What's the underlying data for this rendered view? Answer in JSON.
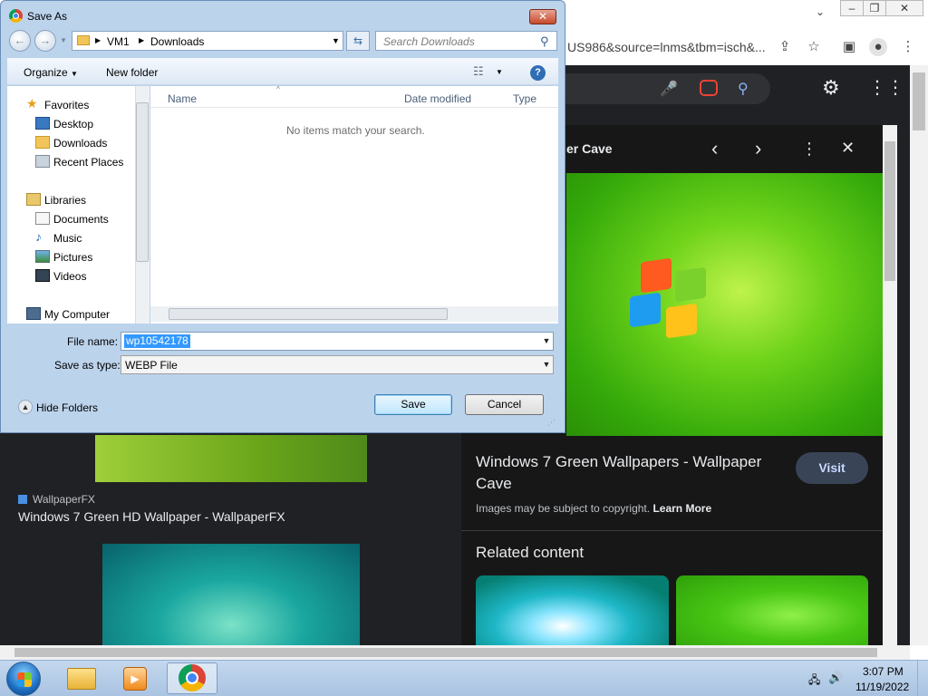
{
  "dialog": {
    "title": "Save As",
    "breadcrumb": [
      "VM1",
      "Downloads"
    ],
    "search_placeholder": "Search Downloads",
    "toolbar": {
      "organize": "Organize",
      "new_folder": "New folder"
    },
    "nav": {
      "favorites": "Favorites",
      "desktop": "Desktop",
      "downloads": "Downloads",
      "recent": "Recent Places",
      "libraries": "Libraries",
      "documents": "Documents",
      "music": "Music",
      "pictures": "Pictures",
      "videos": "Videos",
      "computer": "My Computer"
    },
    "columns": {
      "name": "Name",
      "date": "Date modified",
      "type": "Type"
    },
    "empty_message": "No items match your search.",
    "file_name_label": "File name:",
    "file_name_value": "wp10542178",
    "save_type_label": "Save as type:",
    "save_type_value": "WEBP File",
    "hide_folders": "Hide Folders",
    "save": "Save",
    "cancel": "Cancel"
  },
  "browser": {
    "url_fragment": "US986&source=lnms&tbm=isch&...",
    "preview_title_fragment": "er Cave",
    "result_title": "Windows 7 Green Wallpapers - Wallpaper Cave",
    "visit": "Visit",
    "copyright": "Images may be subject to copyright.",
    "learn_more": "Learn More",
    "related": "Related content",
    "left_source": "WallpaperFX",
    "left_title": "Windows 7 Green HD Wallpaper - WallpaperFX"
  },
  "taskbar": {
    "time": "3:07 PM",
    "date": "11/19/2022"
  },
  "colors": {
    "accent": "#3399ff",
    "dark_bg": "#202124",
    "visit_bg": "#394457"
  }
}
